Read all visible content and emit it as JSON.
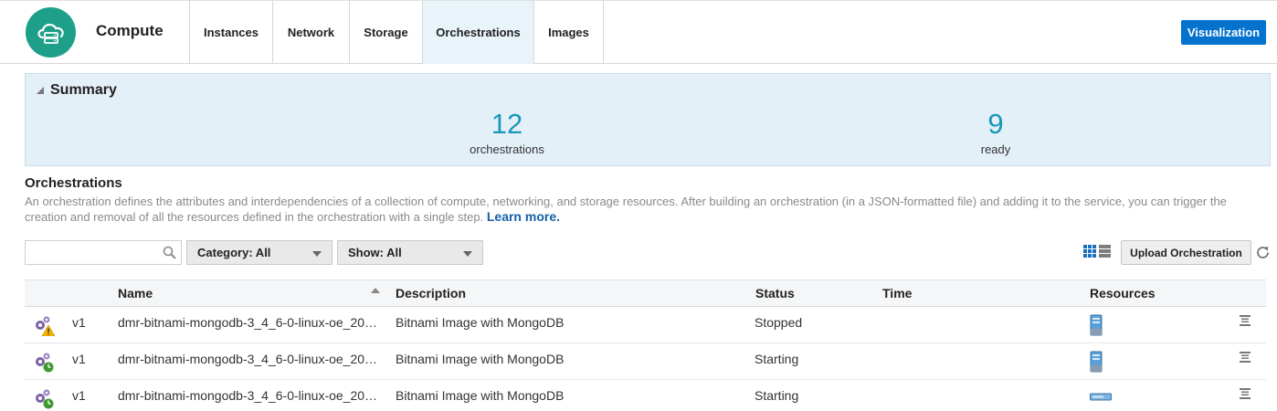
{
  "header": {
    "app_title": "Compute",
    "logo_icon": "cloud-server-icon",
    "tabs": [
      {
        "label": "Instances",
        "active": false
      },
      {
        "label": "Network",
        "active": false
      },
      {
        "label": "Storage",
        "active": false
      },
      {
        "label": "Orchestrations",
        "active": true
      },
      {
        "label": "Images",
        "active": false
      }
    ],
    "visualization_label": "Visualization"
  },
  "summary": {
    "title": "Summary",
    "metrics": [
      {
        "value": "12",
        "label": "orchestrations"
      },
      {
        "value": "9",
        "label": "ready"
      }
    ]
  },
  "section": {
    "title": "Orchestrations",
    "description": "An orchestration defines the attributes and interdependencies of a collection of compute, networking, and storage resources. After building an orchestration (in a JSON-formatted file) and adding it to the service, you can trigger the creation and removal of all the resources defined in the orchestration with a single step.",
    "learn_more": "Learn more."
  },
  "toolbar": {
    "search_value": "",
    "category_label": "Category: All",
    "show_label": "Show: All",
    "upload_label": "Upload Orchestration"
  },
  "table": {
    "headers": {
      "name": "Name",
      "description": "Description",
      "status": "Status",
      "time": "Time",
      "resources": "Resources"
    },
    "rows": [
      {
        "icon": "gears-warning-icon",
        "version": "v1",
        "name": "dmr-bitnami-mongodb-3_4_6-0-linux-oe_20…",
        "description": "Bitnami Image with MongoDB",
        "status": "Stopped",
        "time": "",
        "resource_icon": "server-tower-icon"
      },
      {
        "icon": "gears-clock-icon",
        "version": "v1",
        "name": "dmr-bitnami-mongodb-3_4_6-0-linux-oe_20…",
        "description": "Bitnami Image with MongoDB",
        "status": "Starting",
        "time": "",
        "resource_icon": "server-tower-icon"
      },
      {
        "icon": "gears-clock-icon",
        "version": "v1",
        "name": "dmr-bitnami-mongodb-3_4_6-0-linux-oe_20…",
        "description": "Bitnami Image with MongoDB",
        "status": "Starting",
        "time": "",
        "resource_icon": "storage-volume-icon"
      }
    ]
  },
  "colors": {
    "accent": "#0572ce",
    "logo": "#1d9f8a",
    "metric": "#1899b8",
    "summary_bg": "#e4f0f8",
    "link": "#1460a8"
  }
}
